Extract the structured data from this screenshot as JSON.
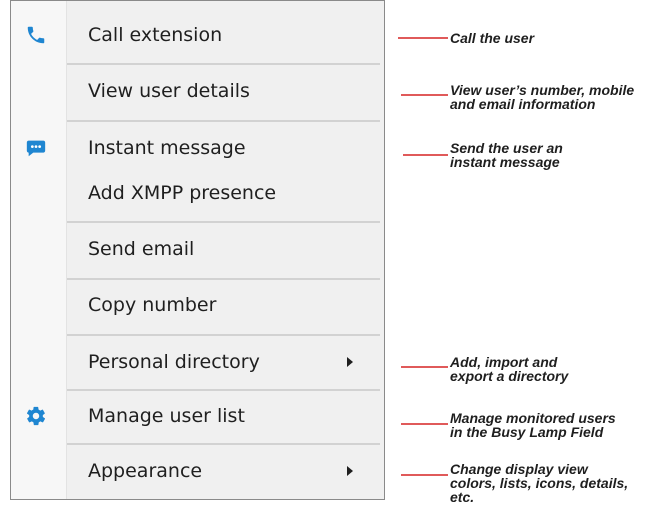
{
  "menu": {
    "items": [
      {
        "label": "Call extension",
        "icon": "phone-icon"
      },
      {
        "label": "View user details"
      },
      {
        "label": "Instant message",
        "icon": "chat-bubble-icon"
      },
      {
        "label": "Add XMPP presence"
      },
      {
        "label": "Send email"
      },
      {
        "label": "Copy number"
      },
      {
        "label": "Personal directory",
        "has_submenu": true
      },
      {
        "label": "Manage user list",
        "icon": "gear-icon"
      },
      {
        "label": "Appearance",
        "has_submenu": true
      }
    ]
  },
  "callouts": [
    {
      "text": "Call the user"
    },
    {
      "text": "View user’s number, mobile\nand email information"
    },
    {
      "text": "Send the user an\ninstant message"
    },
    {
      "text": "Add, import and\nexport a directory"
    },
    {
      "text": "Manage monitored users\nin the Busy Lamp Field"
    },
    {
      "text": "Change display view\ncolors, lists, icons, details,\netc."
    }
  ],
  "colors": {
    "icon_blue": "#1f86d1",
    "callout_line": "#e05a5a",
    "menu_bg": "#f0f0f0",
    "text": "#1f1f1f"
  }
}
